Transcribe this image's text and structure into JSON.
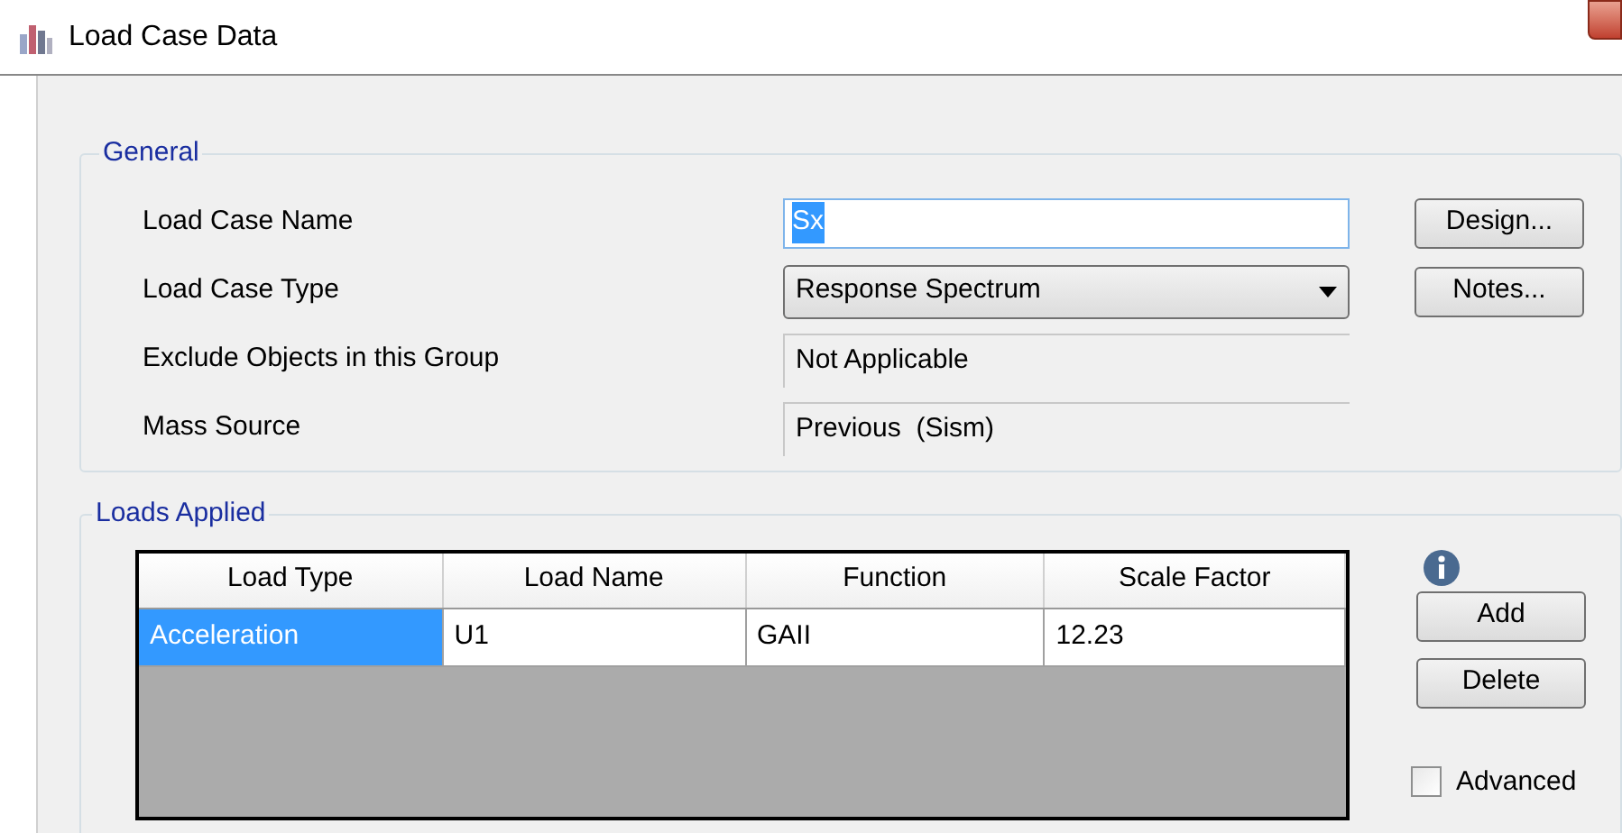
{
  "window": {
    "title": "Load Case Data"
  },
  "general": {
    "legend": "General",
    "fields": [
      {
        "kind": "text",
        "label": "Load Case Name",
        "value": "Sx",
        "highlighted": true
      },
      {
        "kind": "dropdown",
        "label": "Load Case Type",
        "value": "Response Spectrum"
      },
      {
        "kind": "readonly",
        "label": "Exclude Objects in this Group",
        "value": "Not Applicable"
      },
      {
        "kind": "readonly",
        "label": "Mass Source",
        "value": "Previous  (Sism)"
      }
    ],
    "buttons": [
      "Design...",
      "Notes..."
    ]
  },
  "loads_applied": {
    "legend": "Loads Applied",
    "table": {
      "columns": [
        "Load Type",
        "Load Name",
        "Function",
        "Scale Factor"
      ],
      "rows": [
        {
          "cells": [
            "Acceleration",
            "U1",
            "GAII",
            "12.23"
          ],
          "selected": true
        }
      ]
    },
    "buttons": [
      "Add",
      "Delete"
    ],
    "advanced": {
      "label": "Advanced",
      "checked": false
    }
  }
}
